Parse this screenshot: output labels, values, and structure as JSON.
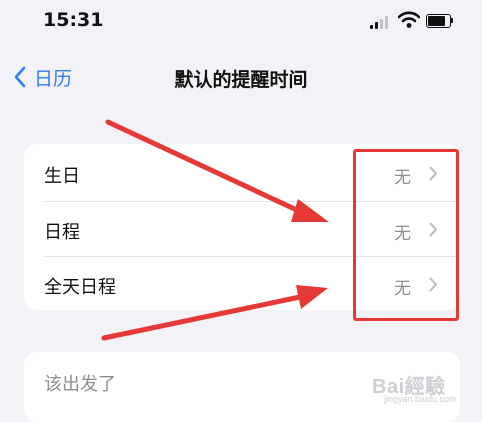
{
  "status_bar": {
    "time": "15:31",
    "icons": [
      "cellular-signal-icon",
      "wifi-icon",
      "battery-icon"
    ]
  },
  "nav": {
    "back_label": "日历",
    "title": "默认的提醒时间"
  },
  "reminder_rows": [
    {
      "label": "生日",
      "value": "无"
    },
    {
      "label": "日程",
      "value": "无"
    },
    {
      "label": "全天日程",
      "value": "无"
    }
  ],
  "second_section": {
    "row_label": "该出发了"
  },
  "watermark": {
    "text": "Bai經驗",
    "subtext": "jingyan.baidu.com"
  },
  "colors": {
    "accent": "#2f7cf6",
    "annotation": "#e53935",
    "background": "#f2f2f7",
    "secondary_text": "#8e8e93"
  }
}
